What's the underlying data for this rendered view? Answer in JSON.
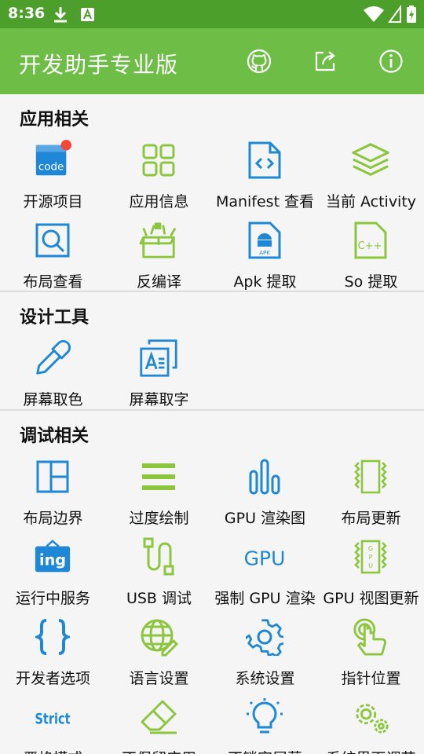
{
  "status": {
    "time": "8:36"
  },
  "app": {
    "title": "开发助手专业版"
  },
  "toolbar_icons": [
    "github-icon",
    "share-icon",
    "info-icon"
  ],
  "colors": {
    "status_bar": "#4c9f2a",
    "app_bar": "#6ebd46",
    "blue": "#1e88d6",
    "green": "#8cc63f",
    "badge": "#f4473b"
  },
  "sections": [
    {
      "title": "应用相关",
      "items": [
        {
          "label": "开源项目",
          "icon": "code-icon"
        },
        {
          "label": "应用信息",
          "icon": "grid-icon"
        },
        {
          "label": "Manifest 查看",
          "icon": "manifest-icon"
        },
        {
          "label": "当前 Activity",
          "icon": "layers-icon"
        },
        {
          "label": "布局查看",
          "icon": "layout-search-icon"
        },
        {
          "label": "反编译",
          "icon": "box-icon"
        },
        {
          "label": "Apk 提取",
          "icon": "apk-icon"
        },
        {
          "label": "So 提取",
          "icon": "cpp-file-icon"
        }
      ]
    },
    {
      "title": "设计工具",
      "items": [
        {
          "label": "屏幕取色",
          "icon": "eyedropper-icon"
        },
        {
          "label": "屏幕取字",
          "icon": "text-capture-icon"
        }
      ]
    },
    {
      "title": "调试相关",
      "items": [
        {
          "label": "布局边界",
          "icon": "layout-bounds-icon"
        },
        {
          "label": "过度绘制",
          "icon": "overdraw-icon"
        },
        {
          "label": "GPU 渲染图",
          "icon": "bar-chart-icon"
        },
        {
          "label": "布局更新",
          "icon": "layout-update-icon"
        },
        {
          "label": "运行中服务",
          "icon": "running-service-icon"
        },
        {
          "label": "USB 调试",
          "icon": "usb-icon"
        },
        {
          "label": "强制 GPU 渲染",
          "icon": "gpu-text-icon"
        },
        {
          "label": "GPU 视图更新",
          "icon": "gpu-view-icon"
        },
        {
          "label": "开发者选项",
          "icon": "braces-icon"
        },
        {
          "label": "语言设置",
          "icon": "globe-icon"
        },
        {
          "label": "系统设置",
          "icon": "settings-icon"
        },
        {
          "label": "指针位置",
          "icon": "pointer-icon"
        },
        {
          "label": "严格模式",
          "icon": "strict-icon"
        },
        {
          "label": "不保留应用",
          "icon": "eraser-icon"
        },
        {
          "label": "不锁定屏幕",
          "icon": "bulb-icon"
        },
        {
          "label": "系统界面调节",
          "icon": "gears-icon"
        }
      ]
    }
  ],
  "icon_text": {
    "code": "code",
    "apk": "APK",
    "cpp": "C++",
    "ing": "ing",
    "gpu": "GPU",
    "strict": "Strict"
  }
}
